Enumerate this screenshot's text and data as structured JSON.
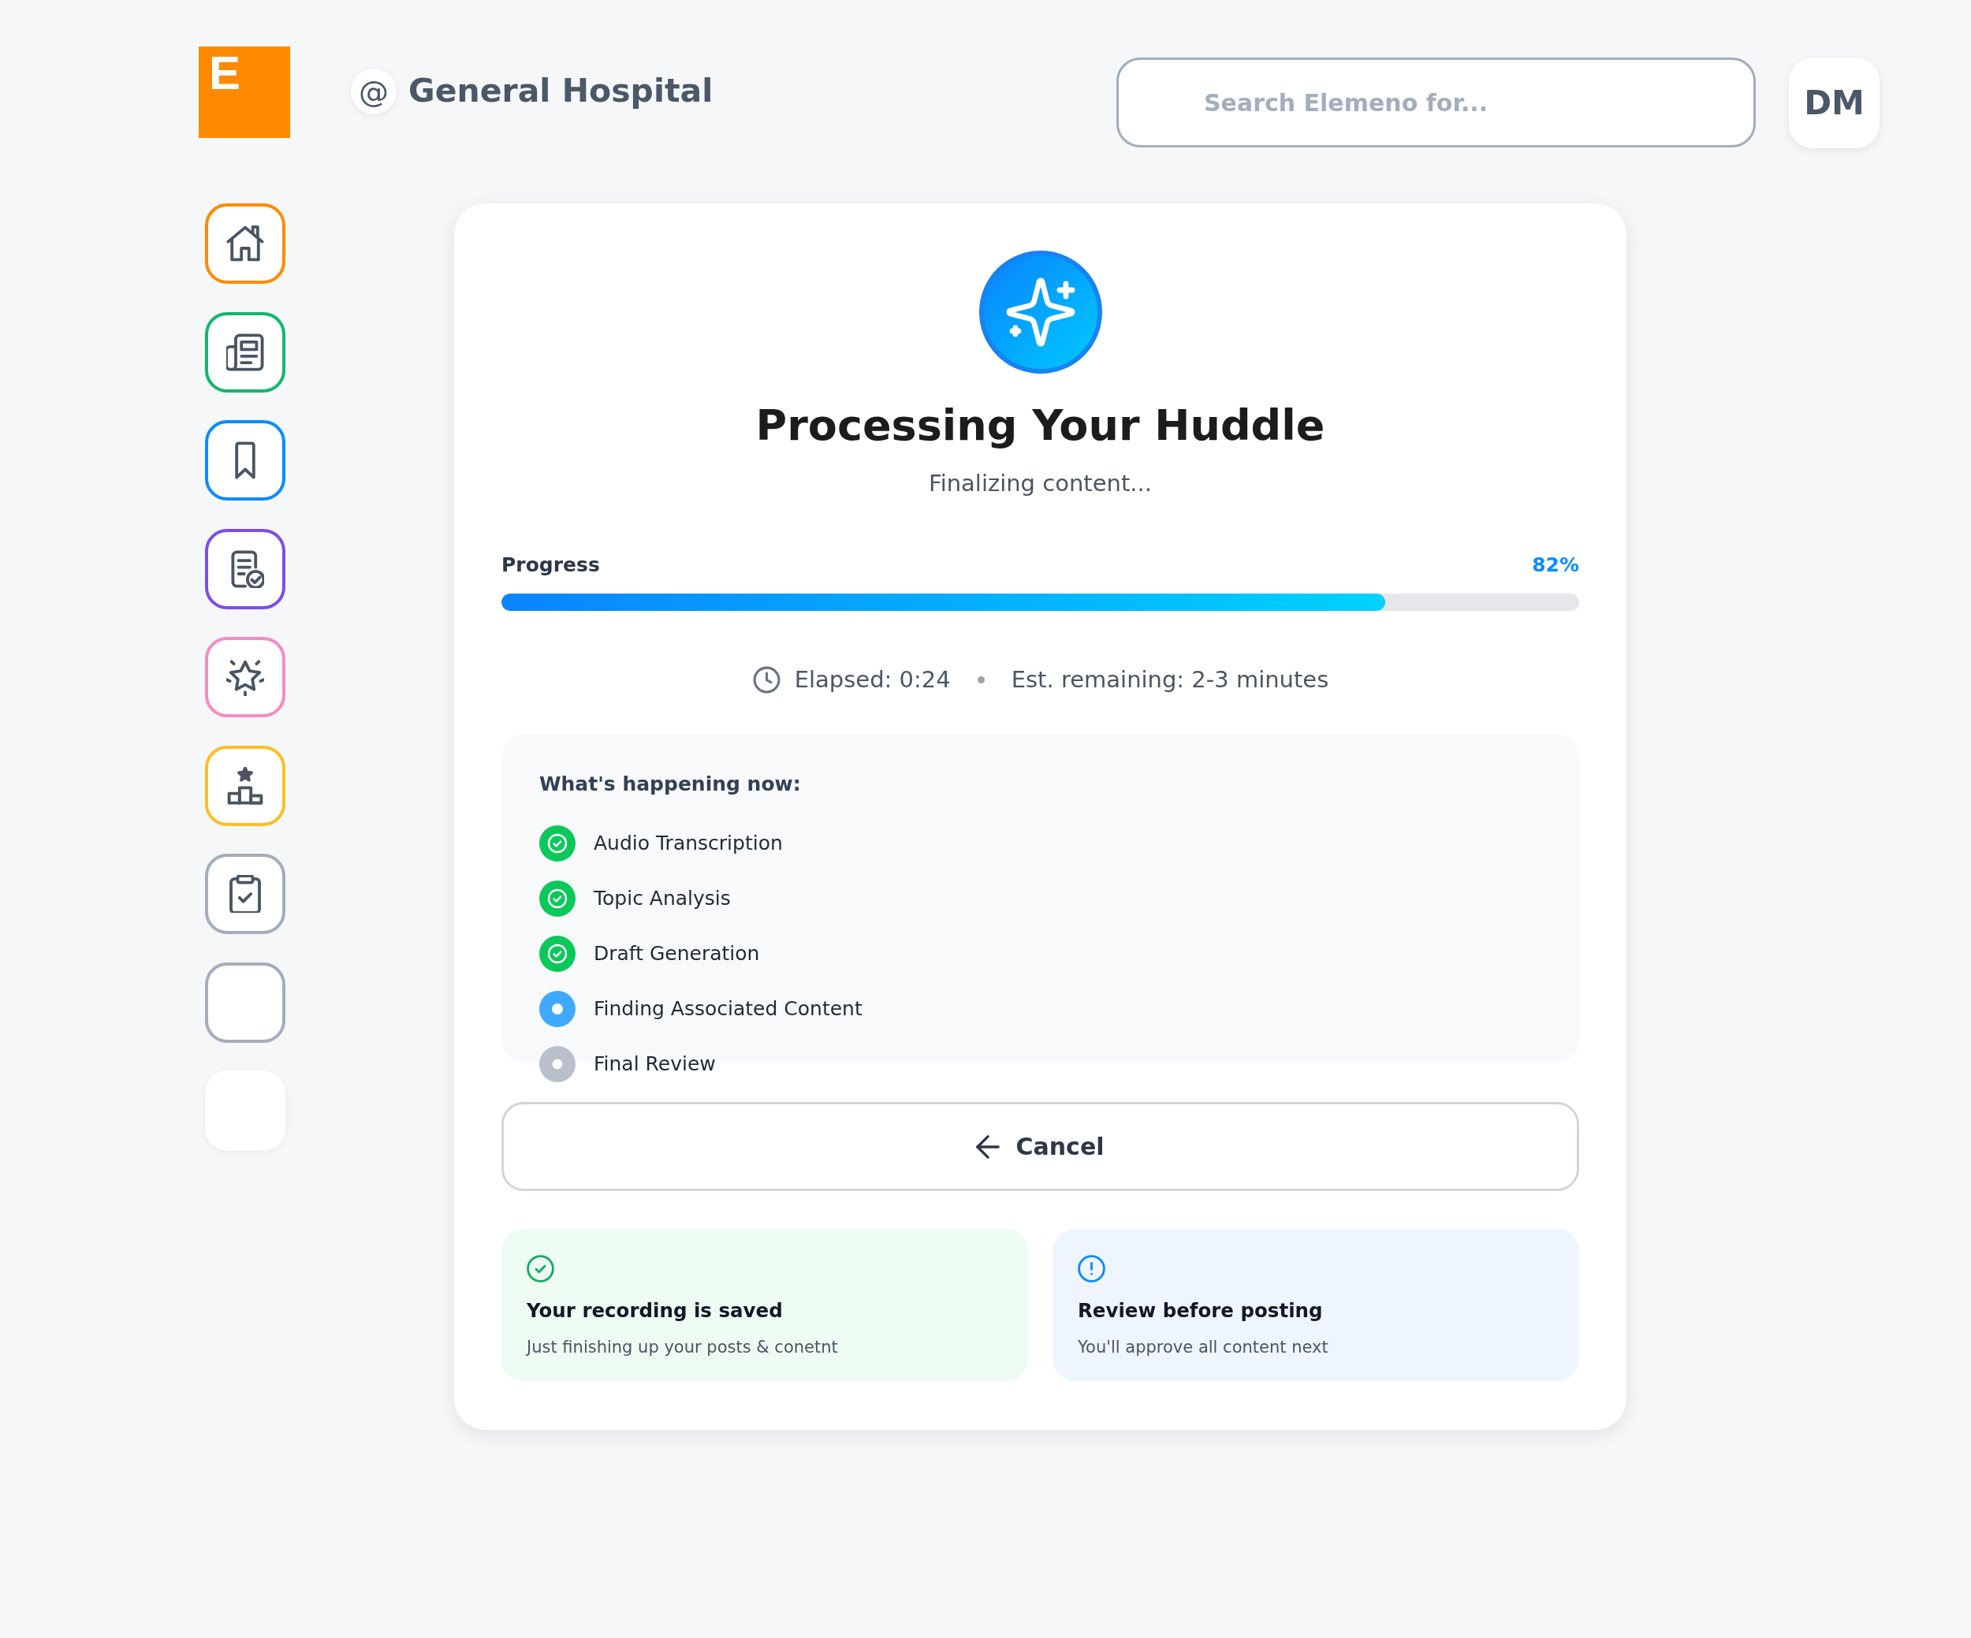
{
  "header": {
    "logo": {
      "letter": "E"
    },
    "workspace": {
      "symbol": "@",
      "name": "General Hospital"
    },
    "search": {
      "placeholder": "Search Elemeno for..."
    },
    "avatar": {
      "initials": "DM"
    }
  },
  "sidebar": {
    "items": [
      {
        "kind": "outlined",
        "color": "#ff8a00"
      },
      {
        "kind": "outlined",
        "color": "#12b76a"
      },
      {
        "kind": "outlined",
        "color": "#0a8cff"
      },
      {
        "kind": "outlined",
        "color": "#7c4dea"
      },
      {
        "kind": "outlined",
        "color": "#f48cc4"
      },
      {
        "kind": "outlined",
        "color": "#fbbf24"
      },
      {
        "kind": "outlined",
        "color": "#a3adbd"
      },
      {
        "kind": "outlined",
        "color": "#a3adbd"
      },
      {
        "kind": "plain"
      }
    ]
  },
  "card": {
    "title": "Processing Your Huddle",
    "subtitle": "Finalizing content...",
    "progress": {
      "label": "Progress",
      "reading": "82%",
      "level": 0.82
    },
    "timing": {
      "elapsed": "Elapsed: 0:24",
      "remaining": "Est. remaining: 2-3 minutes"
    },
    "steps": {
      "heading": "What's happening now:",
      "items": [
        {
          "label": "Audio Transcription",
          "kind": "done"
        },
        {
          "label": "Topic Analysis",
          "kind": "done"
        },
        {
          "label": "Draft Generation",
          "kind": "done"
        },
        {
          "label": "Finding Associated Content",
          "kind": "active"
        },
        {
          "label": "Final Review",
          "kind": "pending"
        }
      ]
    },
    "cancel_button": {
      "label": "Cancel"
    },
    "notices": [
      {
        "kind": "success",
        "title": "Your recording is saved",
        "text": "Just finishing up your posts & conetnt"
      },
      {
        "kind": "info",
        "title": "Review before posting",
        "text": "You'll approve all content next"
      }
    ]
  }
}
